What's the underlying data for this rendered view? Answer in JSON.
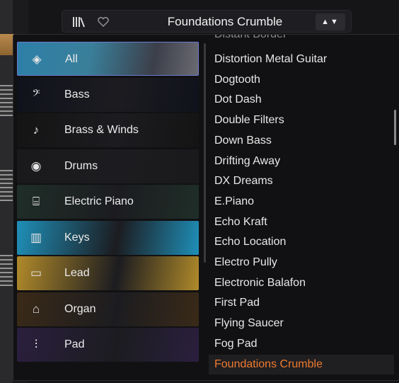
{
  "topbar": {
    "library_icon": "library-icon",
    "heart_icon": "heart-icon",
    "preset_name": "Foundations Crumble",
    "nav_arrows": "▲▼"
  },
  "categories": [
    {
      "label": "All",
      "icon": "layers-icon",
      "glyph": "◈",
      "selected": true,
      "color": "#2d7fa8"
    },
    {
      "label": "Bass",
      "icon": "guitar-icon",
      "glyph": "𝄢",
      "selected": false,
      "color": "#10121c"
    },
    {
      "label": "Brass & Winds",
      "icon": "trumpet-icon",
      "glyph": "♪",
      "selected": false,
      "color": "#141414"
    },
    {
      "label": "Drums",
      "icon": "drum-icon",
      "glyph": "◉",
      "selected": false,
      "color": "#1a1a1c"
    },
    {
      "label": "Electric Piano",
      "icon": "electric-piano-icon",
      "glyph": "⌸",
      "selected": false,
      "color": "#1f2e28"
    },
    {
      "label": "Keys",
      "icon": "keys-icon",
      "glyph": "▥",
      "selected": false,
      "color": "#1f8fb8"
    },
    {
      "label": "Lead",
      "icon": "lead-icon",
      "glyph": "▭",
      "selected": false,
      "color": "#b08a2a"
    },
    {
      "label": "Organ",
      "icon": "organ-icon",
      "glyph": "⌂",
      "selected": false,
      "color": "#3a2a18"
    },
    {
      "label": "Pad",
      "icon": "pad-waveform-icon",
      "glyph": "⫶",
      "selected": false,
      "color": "#2a1f3e"
    }
  ],
  "presets": {
    "partial": "Distant Border",
    "items": [
      "Distortion Metal Guitar",
      "Dogtooth",
      "Dot Dash",
      "Double Filters",
      "Down Bass",
      "Drifting Away",
      "DX Dreams",
      "E.Piano",
      "Echo Kraft",
      "Echo Location",
      "Electro Pully",
      "Electronic Balafon",
      "First Pad",
      "Flying Saucer",
      "Fog Pad",
      "Foundations Crumble"
    ],
    "selected_index": 15
  },
  "colors": {
    "accent_selected": "#f07a2e",
    "selected_border": "#6b7bd0"
  }
}
